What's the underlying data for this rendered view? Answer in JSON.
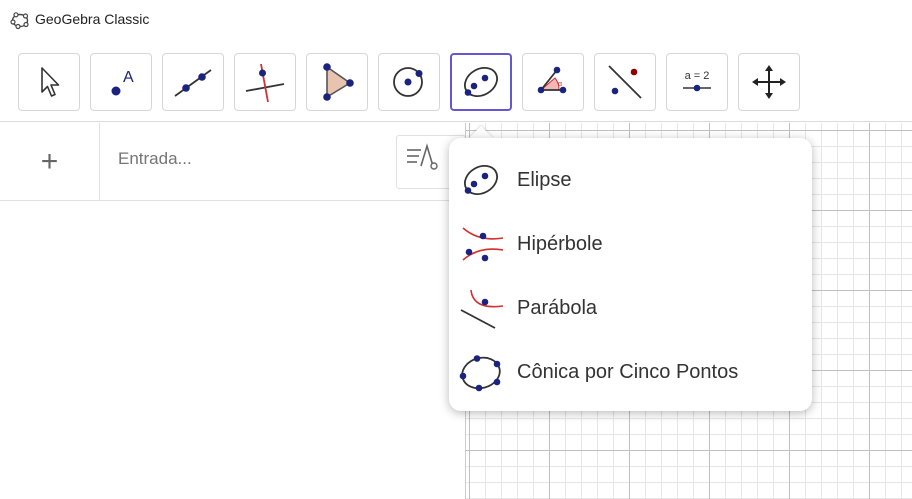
{
  "window": {
    "title": "GeoGebra Classic"
  },
  "toolbar": {
    "tools": [
      {
        "name": "move-tool",
        "icon": "cursor-arrow-icon"
      },
      {
        "name": "point-tool",
        "icon": "point-a-icon"
      },
      {
        "name": "line-tool",
        "icon": "line-through-points-icon"
      },
      {
        "name": "perpendicular-line-tool",
        "icon": "perpendicular-line-icon"
      },
      {
        "name": "polygon-tool",
        "icon": "polygon-icon"
      },
      {
        "name": "circle-tool",
        "icon": "circle-center-point-icon"
      },
      {
        "name": "conic-tool",
        "icon": "ellipse-icon",
        "selected": true
      },
      {
        "name": "angle-tool",
        "icon": "angle-icon"
      },
      {
        "name": "reflect-tool",
        "icon": "reflect-about-line-icon"
      },
      {
        "name": "slider-tool",
        "icon": "slider-icon",
        "text": "a = 2"
      },
      {
        "name": "move-graphics-view-tool",
        "icon": "move-arrows-icon"
      }
    ]
  },
  "algebra": {
    "add_label": "+",
    "input_placeholder": "Entrada...",
    "input_value": ""
  },
  "conic_menu": {
    "items": [
      {
        "label": "Elipse",
        "icon": "ellipse-icon"
      },
      {
        "label": "Hipérbole",
        "icon": "hyperbola-icon"
      },
      {
        "label": "Parábola",
        "icon": "parabola-icon"
      },
      {
        "label": "Cônica por Cinco Pontos",
        "icon": "conic-five-points-icon"
      }
    ]
  },
  "colors": {
    "accent": "#6557d2",
    "point": "#1a237e",
    "conic_curve": "#d32f2f",
    "polygon_fill": "#e8c3b0"
  }
}
